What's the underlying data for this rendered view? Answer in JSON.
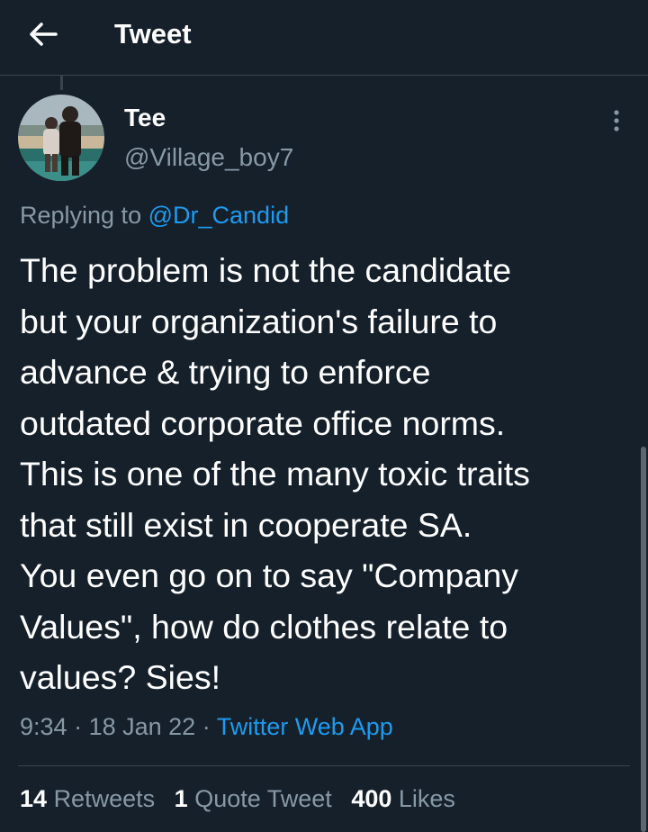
{
  "header": {
    "back_icon": "arrow-left-icon",
    "title": "Tweet"
  },
  "author": {
    "name": "Tee",
    "handle": "@Village_boy7",
    "more_icon": "more-vertical-icon"
  },
  "replying": {
    "prefix": "Replying to",
    "handle": "@Dr_Candid"
  },
  "tweet": {
    "text": "The problem is not the candidate\nbut your organization's failure to\nadvance & trying to enforce\noutdated corporate office norms.\nThis is one of the many toxic traits\nthat still exist in cooperate SA.\nYou even go on to say \"Company\nValues\", how do clothes relate to\nvalues? Sies!",
    "time": "9:34",
    "separator": "·",
    "date": "18 Jan 22",
    "source": "Twitter Web App"
  },
  "stats": {
    "retweets_count": "14",
    "retweets_label": "Retweets",
    "quotes_count": "1",
    "quotes_label": "Quote Tweet",
    "likes_count": "400",
    "likes_label": "Likes"
  },
  "colors": {
    "background": "#15202b",
    "text_primary": "#ffffff",
    "text_secondary": "#8899a6",
    "accent": "#1d9bf0",
    "divider": "#38444d"
  }
}
